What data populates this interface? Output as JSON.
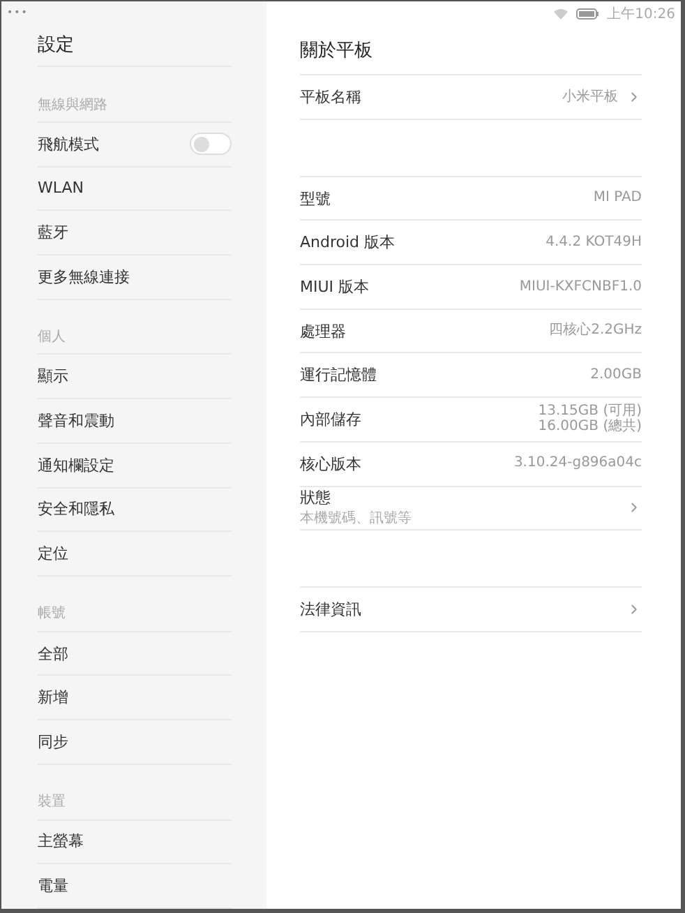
{
  "status_bar": {
    "menu": "•••",
    "time": "上午10:26"
  },
  "sidebar": {
    "title": "設定",
    "sections": [
      {
        "header": "無線與網路",
        "items": [
          {
            "label": "飛航模式",
            "kind": "toggle",
            "on": false
          },
          {
            "label": "WLAN",
            "kind": "plain"
          },
          {
            "label": "藍牙",
            "kind": "plain"
          },
          {
            "label": "更多無線連接",
            "kind": "plain"
          }
        ]
      },
      {
        "header": "個人",
        "items": [
          {
            "label": "顯示",
            "kind": "plain"
          },
          {
            "label": "聲音和震動",
            "kind": "plain"
          },
          {
            "label": "通知欄設定",
            "kind": "plain"
          },
          {
            "label": "安全和隱私",
            "kind": "plain"
          },
          {
            "label": "定位",
            "kind": "plain"
          }
        ]
      },
      {
        "header": "帳號",
        "items": [
          {
            "label": "全部",
            "kind": "plain"
          },
          {
            "label": "新增",
            "kind": "plain"
          },
          {
            "label": "同步",
            "kind": "plain"
          }
        ]
      },
      {
        "header": "裝置",
        "items": [
          {
            "label": "主螢幕",
            "kind": "plain"
          },
          {
            "label": "電量",
            "kind": "plain"
          }
        ]
      }
    ]
  },
  "detail": {
    "title": "關於平板",
    "groups": [
      {
        "rows": [
          {
            "label": "平板名稱",
            "values": [
              "小米平板"
            ],
            "chevron": true
          }
        ]
      },
      {
        "rows": [
          {
            "label": "型號",
            "values": [
              "MI PAD"
            ],
            "chevron": false
          },
          {
            "label": "Android 版本",
            "values": [
              "4.4.2 KOT49H"
            ],
            "chevron": false
          },
          {
            "label": "MIUI 版本",
            "values": [
              "MIUI-KXFCNBF1.0"
            ],
            "chevron": false
          },
          {
            "label": "處理器",
            "values": [
              "四核心2.2GHz"
            ],
            "chevron": false
          },
          {
            "label": "運行記憶體",
            "values": [
              "2.00GB"
            ],
            "chevron": false
          },
          {
            "label": "內部儲存",
            "values": [
              "13.15GB (可用)",
              "16.00GB (總共)"
            ],
            "chevron": false
          },
          {
            "label": "核心版本",
            "values": [
              "3.10.24-g896a04c"
            ],
            "chevron": false
          },
          {
            "label": "狀態",
            "subtitle": "本機號碼、訊號等",
            "chevron": true
          }
        ]
      },
      {
        "rows": [
          {
            "label": "法律資訊",
            "chevron": true
          }
        ]
      }
    ]
  }
}
